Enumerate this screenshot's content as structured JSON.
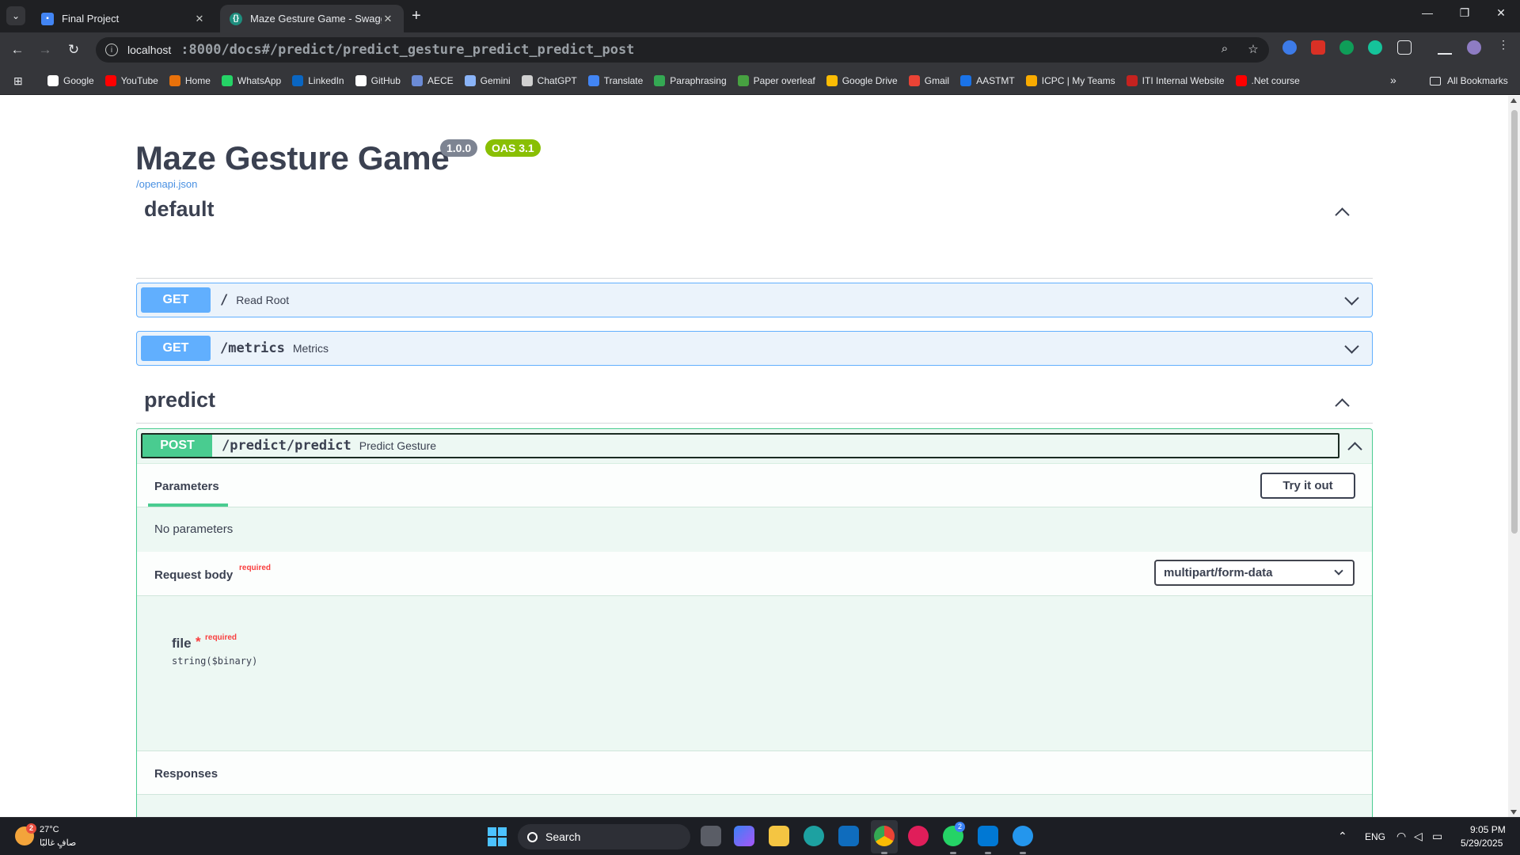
{
  "browser": {
    "tabs": [
      {
        "title": "Final Project",
        "active": false
      },
      {
        "title": "Maze Gesture Game - Swagger",
        "active": true
      }
    ],
    "url_host": "localhost",
    "url_rest": ":8000/docs#/predict/predict_gesture_predict_predict_post",
    "bookmarks": [
      {
        "label": "Google",
        "icon": "google-icon",
        "color": "#ffffff"
      },
      {
        "label": "YouTube",
        "icon": "youtube-icon",
        "color": "#ff0000"
      },
      {
        "label": "Home",
        "icon": "home-icon",
        "color": "#e8710a"
      },
      {
        "label": "WhatsApp",
        "icon": "whatsapp-icon",
        "color": "#25d366"
      },
      {
        "label": "LinkedIn",
        "icon": "linkedin-icon",
        "color": "#0a66c2"
      },
      {
        "label": "GitHub",
        "icon": "github-icon",
        "color": "#ffffff"
      },
      {
        "label": "AECE",
        "icon": "aece-icon",
        "color": "#6b8bd6"
      },
      {
        "label": "Gemini",
        "icon": "gemini-icon",
        "color": "#8ab4f8"
      },
      {
        "label": "ChatGPT",
        "icon": "chatgpt-icon",
        "color": "#d0d0d0"
      },
      {
        "label": "Translate",
        "icon": "translate-icon",
        "color": "#4285f4"
      },
      {
        "label": "Paraphrasing",
        "icon": "paraphrasing-icon",
        "color": "#34a853"
      },
      {
        "label": "Paper overleaf",
        "icon": "overleaf-icon",
        "color": "#47a141"
      },
      {
        "label": "Google Drive",
        "icon": "drive-icon",
        "color": "#fbbc04"
      },
      {
        "label": "Gmail",
        "icon": "gmail-icon",
        "color": "#ea4335"
      },
      {
        "label": "AASTMT",
        "icon": "aastmt-icon",
        "color": "#1a73e8"
      },
      {
        "label": "ICPC | My Teams",
        "icon": "icpc-icon",
        "color": "#f9ab00"
      },
      {
        "label": "ITI Internal Website",
        "icon": "iti-icon",
        "color": "#c5221f"
      },
      {
        "label": ".Net course",
        "icon": "youtube-icon",
        "color": "#ff0000"
      }
    ],
    "all_bookmarks": "All Bookmarks"
  },
  "swagger": {
    "title": "Maze Gesture Game",
    "version": "1.0.0",
    "oas": "OAS 3.1",
    "spec_link": "/openapi.json",
    "sections": {
      "default": "default",
      "predict": "predict"
    },
    "ops": {
      "root": {
        "method": "GET",
        "path": "/",
        "summary": "Read Root"
      },
      "metrics": {
        "method": "GET",
        "path": "/metrics",
        "summary": "Metrics"
      },
      "predict": {
        "method": "POST",
        "path": "/predict/predict",
        "summary": "Predict Gesture"
      }
    },
    "parameters_tab": "Parameters",
    "try_it_out": "Try it out",
    "no_parameters": "No parameters",
    "request_body": "Request body",
    "required": "required",
    "content_type": "multipart/form-data",
    "field_name": "file",
    "field_star": "*",
    "field_type": "string($binary)",
    "responses": "Responses",
    "colors": {
      "get": "#61affe",
      "post": "#49cc90",
      "required": "#f93e3e",
      "oas": "#89bf04"
    }
  },
  "taskbar": {
    "temperature": "27°C",
    "weather": "صافٍ غالبًا",
    "weather_badge": "2",
    "search": "Search",
    "language": "ENG",
    "time": "9:05 PM",
    "date": "5/29/2025",
    "whatsapp_badge": "2"
  }
}
